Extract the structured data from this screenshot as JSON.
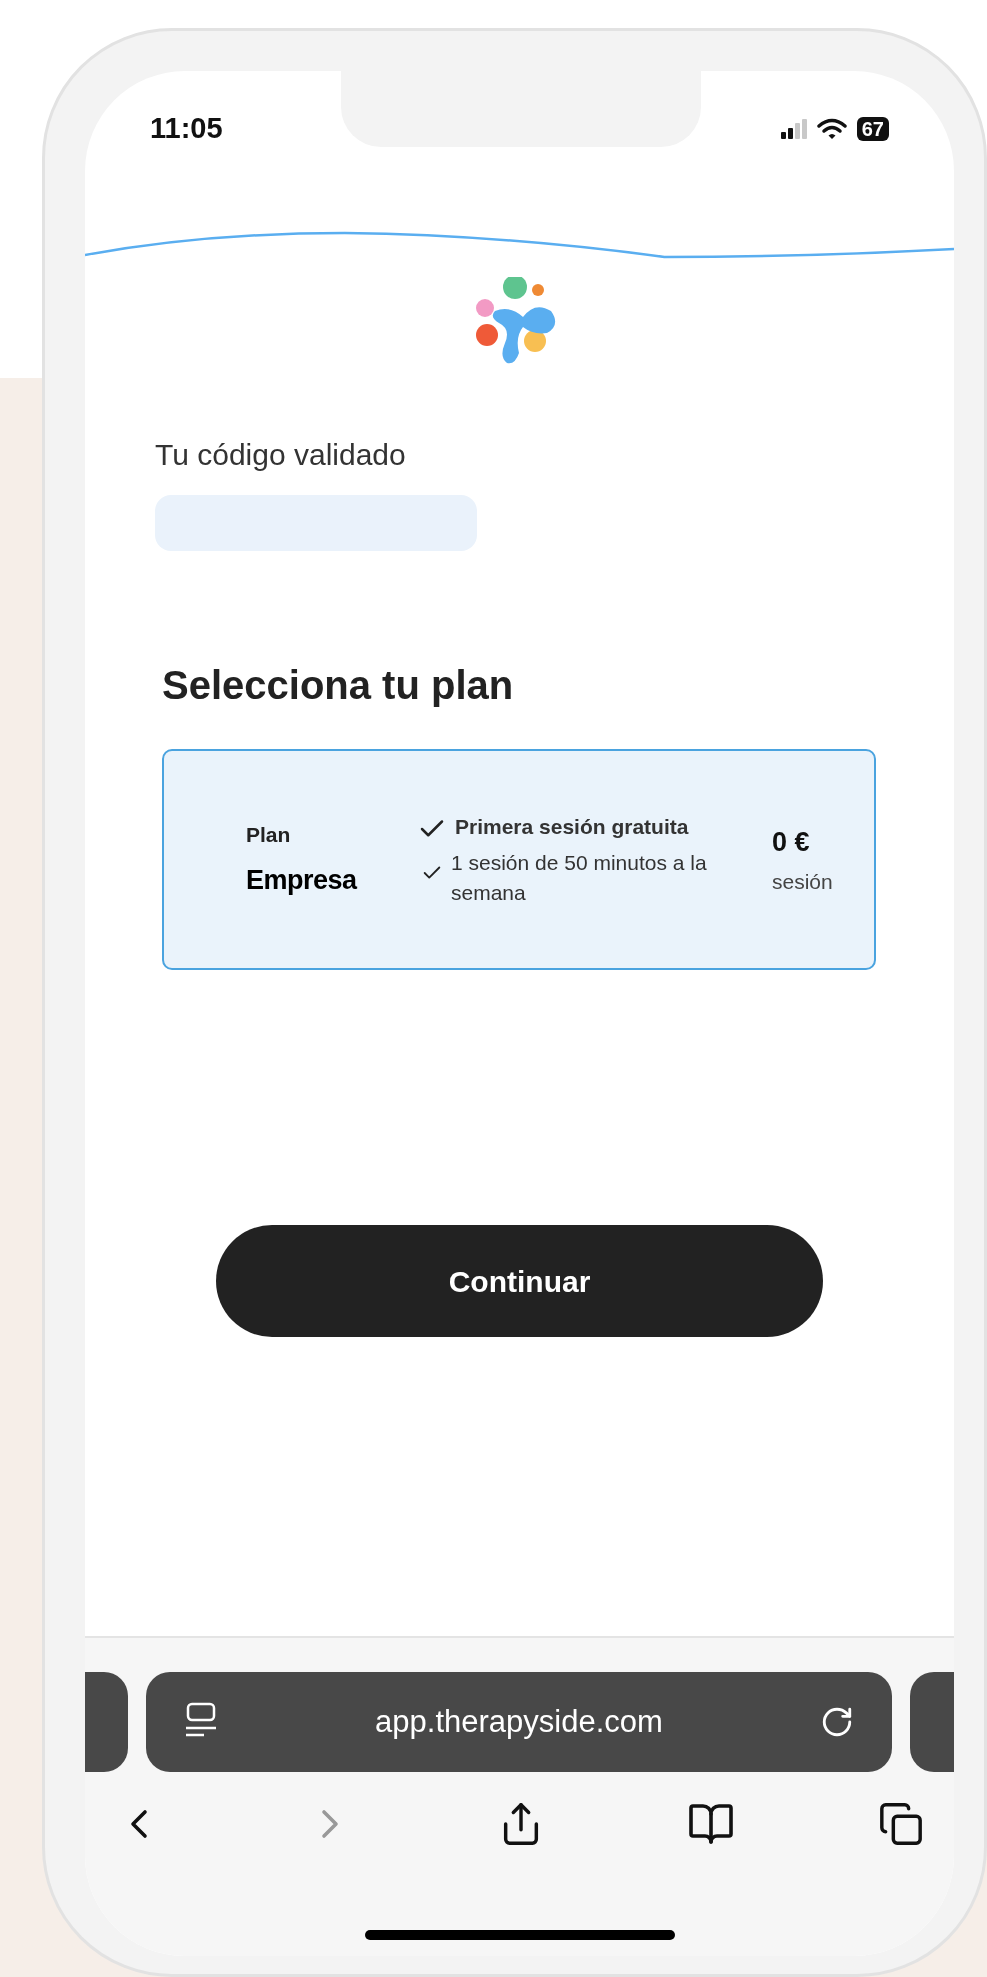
{
  "status_bar": {
    "time": "11:05",
    "battery": "67"
  },
  "code_section": {
    "label": "Tu código validado"
  },
  "heading": "Selecciona tu plan",
  "plans": [
    {
      "label": "Plan",
      "name": "Empresa",
      "features": [
        {
          "text": "Primera sesión gratuita",
          "bold": true
        },
        {
          "text": "1 sesión de 50 minutos a la semana",
          "bold": false
        }
      ],
      "price": "0 €",
      "unit": "sesión",
      "selected": true
    }
  ],
  "button": "Continuar",
  "browser": {
    "url": "app.therapyside.com",
    "forward_disabled": true
  }
}
